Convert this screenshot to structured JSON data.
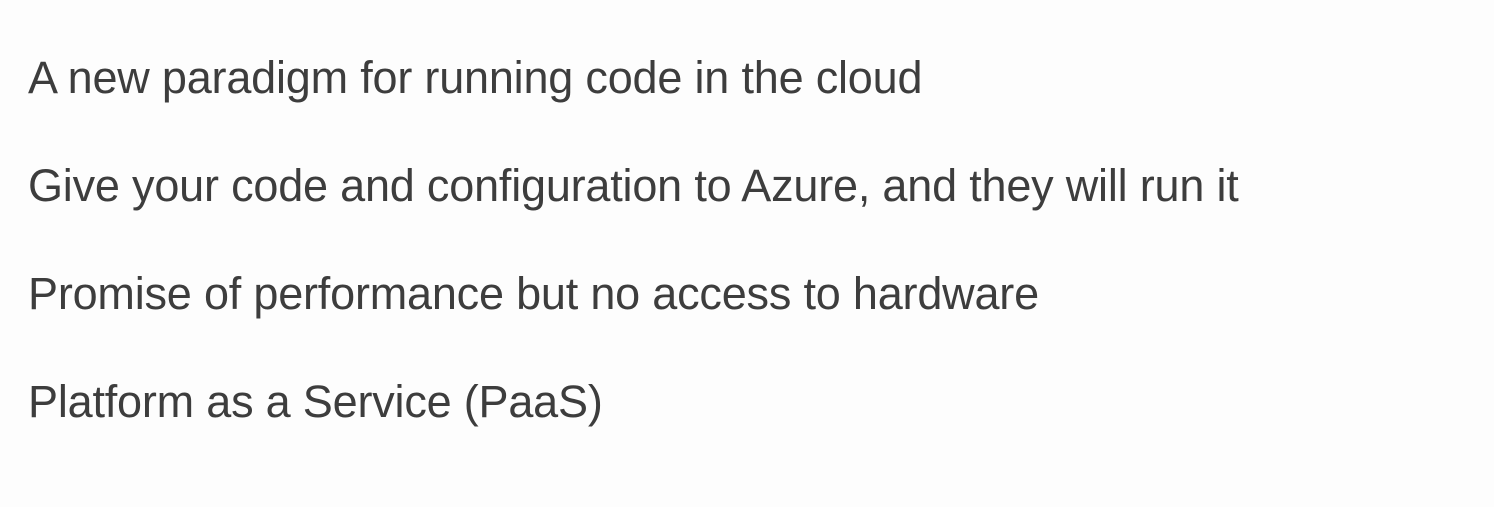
{
  "lines": [
    "A new paradigm for running code in the cloud",
    "Give your code and configuration to Azure, and they will run it",
    "Promise of performance but no access to hardware",
    "Platform as a Service (PaaS)"
  ]
}
